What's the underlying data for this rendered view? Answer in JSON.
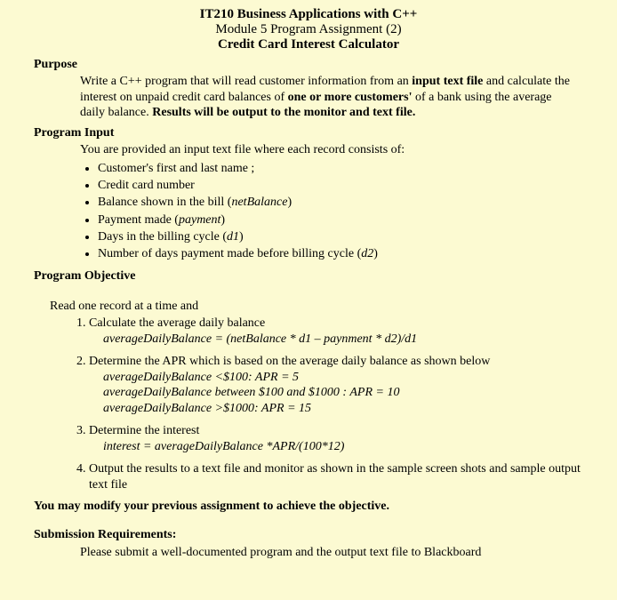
{
  "title": {
    "line1": "IT210 Business Applications with C++",
    "line2": "Module 5 Program Assignment (2)",
    "line3": "Credit Card Interest Calculator"
  },
  "purpose": {
    "heading": "Purpose",
    "t1": "Write a C++ program that will read customer information from an ",
    "b1": "input text file",
    "t2": " and calculate the interest on unpaid credit card balances of ",
    "b2": "one or more customers'",
    "t3": " of a bank using the average daily balance.  ",
    "b3": "Results will be output to the monitor and text file."
  },
  "input": {
    "heading": "Program Input",
    "lead": "You are provided an input text file where each record consists of:",
    "items": {
      "i0a": "Customer's  first and last name ;",
      "i1a": "Credit card number",
      "i2a": "Balance shown in the bill (",
      "i2b": "netBalance",
      "i2c": ")",
      "i3a": "Payment made (",
      "i3b": "payment",
      "i3c": ")",
      "i4a": "Days in the billing cycle (",
      "i4b": "d1",
      "i4c": ")",
      "i5a": "Number of days payment made before billing cycle (",
      "i5b": "d2",
      "i5c": ")"
    }
  },
  "objective": {
    "heading": "Program Objective",
    "lead": "Read one record at a time and",
    "s1": {
      "t": "Calculate the average daily balance",
      "f": "averageDailyBalance  =  (netBalance * d1 – paynment * d2)/d1"
    },
    "s2": {
      "t": "Determine the APR which is based on the average daily balance as shown below",
      "l1": "averageDailyBalance <$100: APR = 5",
      "l2": "averageDailyBalance  between $100 and $1000 : APR = 10",
      "l3": "averageDailyBalance >$1000:  APR = 15"
    },
    "s3": {
      "t": "Determine the interest",
      "f": "interest = averageDailyBalance *APR/(100*12)"
    },
    "s4": {
      "t": "Output the results to a text file and monitor as shown in the sample screen shots and sample output text file"
    }
  },
  "note": "You may modify your previous assignment to achieve the objective.",
  "submission": {
    "heading": "Submission Requirements:",
    "text": "Please submit a well-documented program and the output text file to Blackboard"
  }
}
